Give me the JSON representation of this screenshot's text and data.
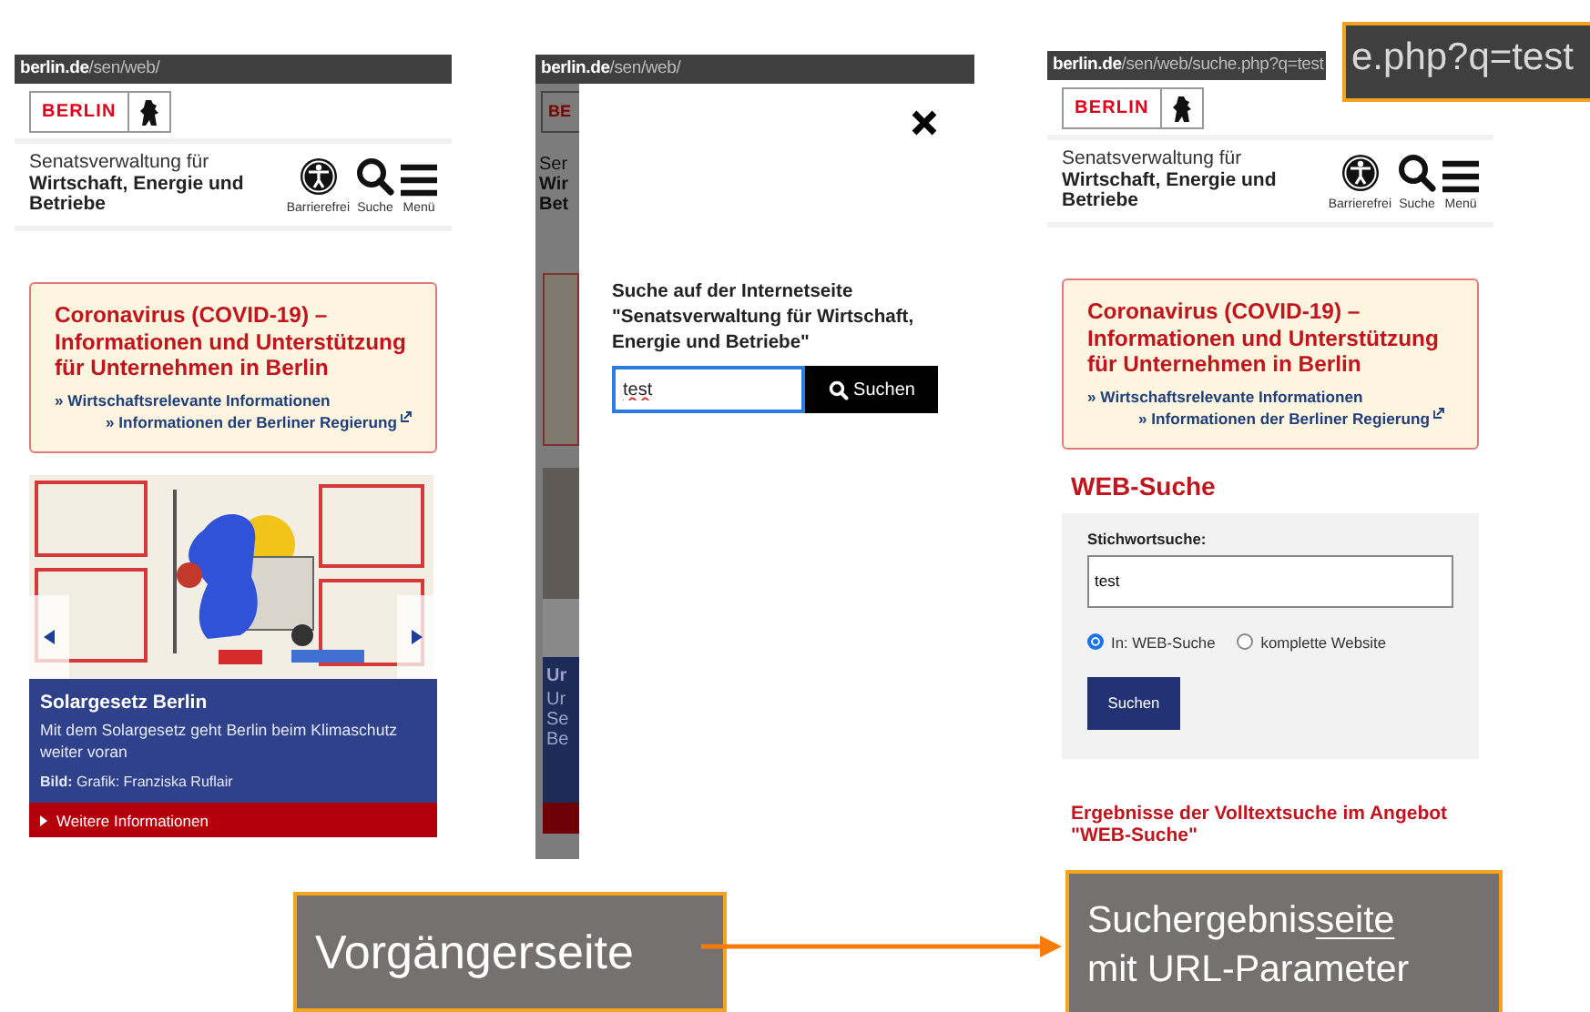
{
  "panels": [
    {
      "kind": "home",
      "url": {
        "host": "berlin.de",
        "path": "/sen/web/"
      },
      "logo": "BERLIN",
      "org": {
        "line1": "Senatsverwaltung für",
        "line2": "Wirtschaft, Energie und Betriebe"
      },
      "header_actions": [
        "Barrierefrei",
        "Suche",
        "Menü"
      ],
      "notice": {
        "title": "Coronavirus (COVID-19) – Informationen und Unterstützung für Unternehmen in Berlin",
        "links": [
          "» Wirtschaftsrelevante Informationen",
          "» Informationen der Berliner Regierung"
        ]
      },
      "slide": {
        "title": "Solargesetz Berlin",
        "text": "Mit dem Solargesetz geht Berlin beim Klimaschutz weiter voran",
        "credit": "**Bild:** Grafik: Franziska Ruflair",
        "more": "Weitere Informationen"
      }
    },
    {
      "kind": "search_dialog",
      "url": {
        "host": "berlin.de",
        "path": "/sen/web/"
      },
      "background_fragments": {
        "logo": "BE",
        "header": [
          "Ser",
          "Wir",
          "Bet"
        ],
        "caption": [
          "Ur",
          "Ur",
          "Se",
          "Be"
        ]
      },
      "dialog": {
        "prompt": "Suche auf der Internetseite \"Senatsverwaltung für Wirtschaft, Energie und Betriebe\"",
        "query": "test",
        "button": "Suchen"
      }
    },
    {
      "kind": "results",
      "url": {
        "host": "berlin.de",
        "path": "/sen/web/suche.php?q=test"
      },
      "logo": "BERLIN",
      "org": {
        "line1": "Senatsverwaltung für",
        "line2": "Wirtschaft, Energie und Betriebe"
      },
      "header_actions": [
        "Barrierefrei",
        "Suche",
        "Menü"
      ],
      "notice": {
        "title": "Coronavirus (COVID-19) – Informationen und Unterstützung für Unternehmen in Berlin",
        "links": [
          "» Wirtschaftsrelevante Informationen",
          "» Informationen der Berliner Regierung"
        ]
      },
      "heading": "WEB-Suche",
      "form": {
        "label": "Stichwortsuche:",
        "value": "test",
        "scopes": [
          {
            "label": "In: WEB-Suche",
            "selected": true
          },
          {
            "label": "komplette Website",
            "selected": false
          }
        ],
        "button": "Suchen"
      },
      "results_heading": "Ergebnisse der Volltextsuche im Angebot \"WEB-Suche\""
    }
  ],
  "url_zoom": "e.php?q=test",
  "annotations": [
    {
      "text": "Vorgängerseite"
    },
    {
      "lead": "Suchergebnis",
      "underlined": "seite",
      "rest": "mit URL-Parameter"
    }
  ]
}
